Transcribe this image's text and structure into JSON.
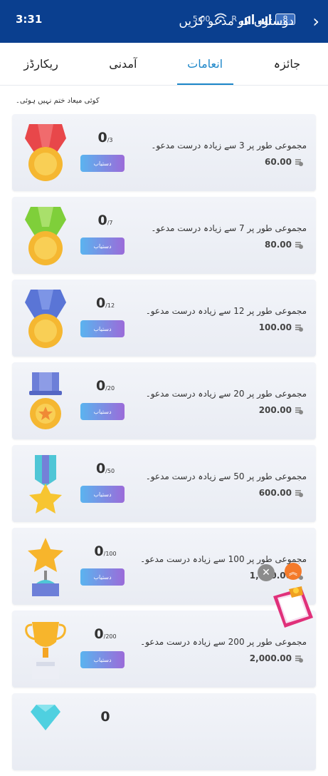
{
  "status": {
    "time": "3:31",
    "speed": "5.00",
    "r": "R",
    "battery": "8"
  },
  "header": {
    "title": "دوستوں کو مدعو کریں"
  },
  "tabs": [
    {
      "label": "جائزہ"
    },
    {
      "label": "انعامات"
    },
    {
      "label": "آمدنی"
    },
    {
      "label": "ریکارڈز"
    }
  ],
  "notice": "کوئی میعاد ختم نہیں ہوئی۔",
  "claim_label": "دستیاب",
  "rewards": [
    {
      "count": "0",
      "target": "/3",
      "description": "مجموعی طور پر 3 سے زیادہ درست مدعو۔",
      "amount": "60.00",
      "medal": "red-medal-icon"
    },
    {
      "count": "0",
      "target": "/7",
      "description": "مجموعی طور پر 7 سے زیادہ درست مدعو۔",
      "amount": "80.00",
      "medal": "green-medal-icon"
    },
    {
      "count": "0",
      "target": "/12",
      "description": "مجموعی طور پر 12 سے زیادہ درست مدعو۔",
      "amount": "100.00",
      "medal": "blue-medal-icon"
    },
    {
      "count": "0",
      "target": "/20",
      "description": "مجموعی طور پر 20 سے زیادہ درست مدعو۔",
      "amount": "200.00",
      "medal": "bar-medal-icon"
    },
    {
      "count": "0",
      "target": "/50",
      "description": "مجموعی طور پر 50 سے زیادہ درست مدعو۔",
      "amount": "600.00",
      "medal": "star-medal-icon"
    },
    {
      "count": "0",
      "target": "/100",
      "description": "مجموعی طور پر 100 سے زیادہ درست مدعو۔",
      "amount": "1,000.00",
      "medal": "star-trophy-icon"
    },
    {
      "count": "0",
      "target": "/200",
      "description": "مجموعی طور پر 200 سے زیادہ درست مدعو۔",
      "amount": "2,000.00",
      "medal": "cup-trophy-icon"
    },
    {
      "count": "0",
      "target": "",
      "description": "",
      "amount": "",
      "medal": "diamond-icon"
    }
  ],
  "floating": {
    "close": "✕",
    "up": "︽"
  }
}
